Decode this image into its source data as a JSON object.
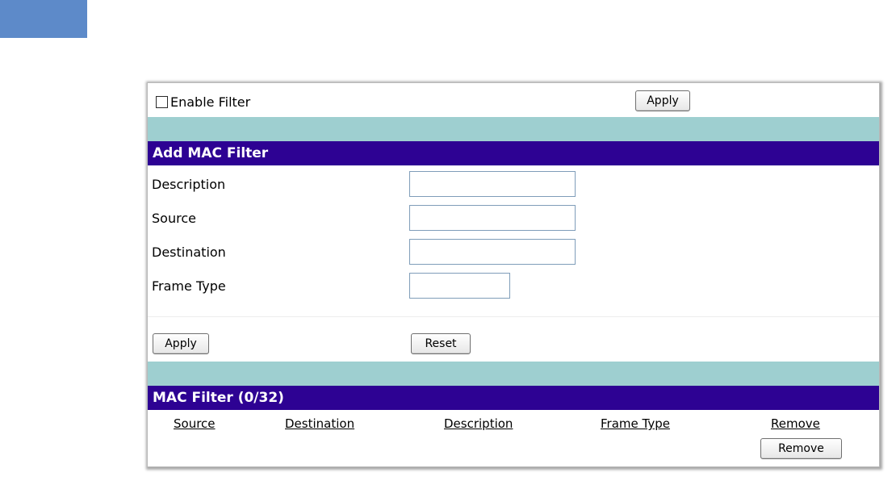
{
  "enable_section": {
    "checkbox_checked": false,
    "enable_label": "Enable Filter",
    "apply_label": "Apply"
  },
  "add_section": {
    "title": "Add MAC Filter",
    "fields": [
      {
        "label": "Description",
        "value": "",
        "placeholder": ""
      },
      {
        "label": "Source",
        "value": "",
        "placeholder": ""
      },
      {
        "label": "Destination",
        "value": "",
        "placeholder": ""
      },
      {
        "label": "Frame Type",
        "value": "",
        "placeholder": ""
      }
    ],
    "apply_label": "Apply",
    "reset_label": "Reset"
  },
  "list_section": {
    "title": "MAC Filter (0/32)",
    "columns": [
      "Source",
      "Destination",
      "Description",
      "Frame Type",
      "Remove"
    ],
    "remove_button_label": "Remove"
  },
  "colors": {
    "corner_tab": "#5d8ac9",
    "separator_bar": "#9ecfd0",
    "header_bar": "#2d0293",
    "header_text": "#ffffff"
  }
}
